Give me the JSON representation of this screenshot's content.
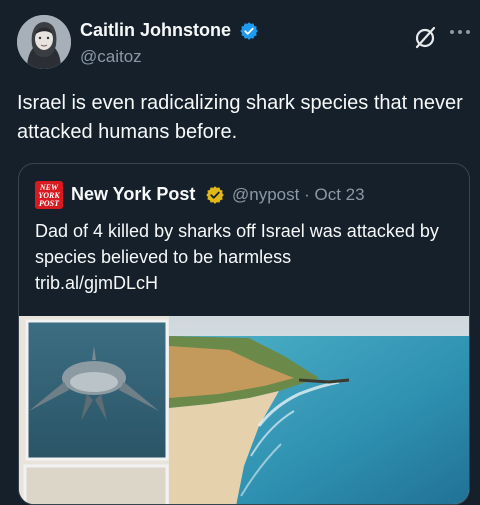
{
  "author": {
    "name": "Caitlin Johnstone",
    "handle": "@caitoz",
    "avatar_icon": "profile-photo",
    "verified_icon": "verified-badge-icon",
    "verified_color": "#1d9bf0"
  },
  "tweet": {
    "text": "Israel is even radicalizing shark species that never attacked humans before."
  },
  "quoted": {
    "logo_text": "NEW YORK POST",
    "author": "New York Post",
    "badge_icon": "gold-verified-badge-icon",
    "badge_color": "#e2b719",
    "handle": "@nypost",
    "separator": "·",
    "date": "Oct 23",
    "text": "Dad of 4 killed by sharks off Israel was attacked by species believed to be harmless",
    "link": "trib.al/gjmDLcH",
    "media_icon": "shark-and-beach-photo"
  },
  "colors": {
    "background": "#15202b",
    "text": "#f7f9f9",
    "secondary": "#8b98a5",
    "border": "#38444d",
    "nyp_red": "#d71920"
  }
}
